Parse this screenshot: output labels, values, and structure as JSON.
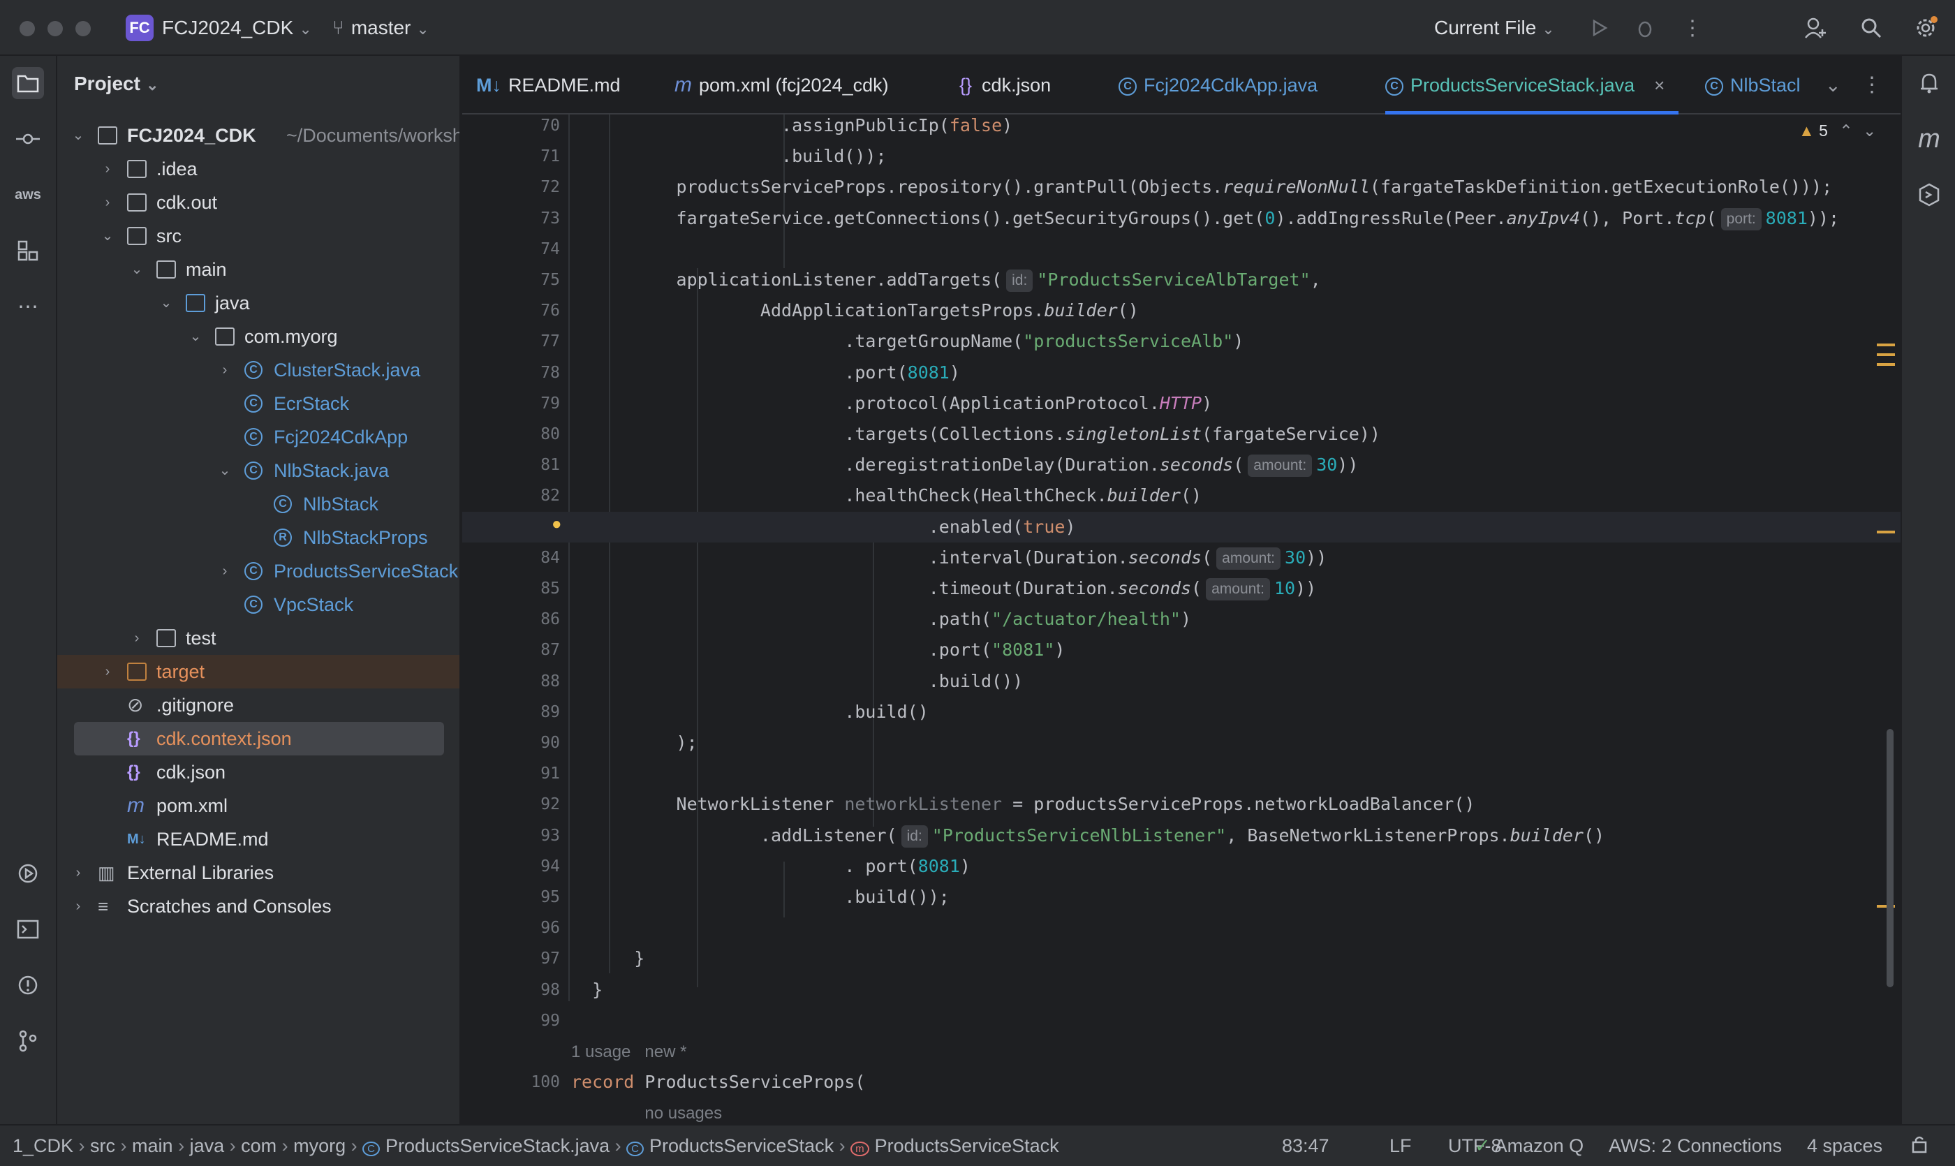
{
  "titlebar": {
    "project_badge": "FC",
    "project_name": "FCJ2024_CDK",
    "branch": "master",
    "run_config": "Current File"
  },
  "sidebar": {
    "title": "Project",
    "tree": [
      {
        "label": "FCJ2024_CDK",
        "path": "~/Documents/worksho",
        "indent": 0,
        "arrow": "⌄",
        "icon": "folder-module"
      },
      {
        "label": ".idea",
        "indent": 1,
        "arrow": "›",
        "icon": "folder"
      },
      {
        "label": "cdk.out",
        "indent": 1,
        "arrow": "›",
        "icon": "folder"
      },
      {
        "label": "src",
        "indent": 1,
        "arrow": "⌄",
        "icon": "folder"
      },
      {
        "label": "main",
        "indent": 2,
        "arrow": "⌄",
        "icon": "folder"
      },
      {
        "label": "java",
        "indent": 3,
        "arrow": "⌄",
        "icon": "folder-blue"
      },
      {
        "label": "com.myorg",
        "indent": 4,
        "arrow": "⌄",
        "icon": "package"
      },
      {
        "label": "ClusterStack.java",
        "indent": 5,
        "arrow": "›",
        "icon": "class"
      },
      {
        "label": "EcrStack",
        "indent": 5,
        "arrow": "",
        "icon": "class"
      },
      {
        "label": "Fcj2024CdkApp",
        "indent": 5,
        "arrow": "",
        "icon": "class"
      },
      {
        "label": "NlbStack.java",
        "indent": 5,
        "arrow": "⌄",
        "icon": "class"
      },
      {
        "label": "NlbStack",
        "indent": 6,
        "arrow": "",
        "icon": "class"
      },
      {
        "label": "NlbStackProps",
        "indent": 6,
        "arrow": "",
        "icon": "record"
      },
      {
        "label": "ProductsServiceStack.j",
        "indent": 5,
        "arrow": "›",
        "icon": "class"
      },
      {
        "label": "VpcStack",
        "indent": 5,
        "arrow": "",
        "icon": "class"
      },
      {
        "label": "test",
        "indent": 2,
        "arrow": "›",
        "icon": "folder"
      },
      {
        "label": "target",
        "indent": 1,
        "arrow": "›",
        "icon": "folder-orange"
      },
      {
        "label": ".gitignore",
        "indent": 1,
        "arrow": "",
        "icon": "ignore"
      },
      {
        "label": "cdk.context.json",
        "indent": 1,
        "arrow": "",
        "icon": "json"
      },
      {
        "label": "cdk.json",
        "indent": 1,
        "arrow": "",
        "icon": "json"
      },
      {
        "label": "pom.xml",
        "indent": 1,
        "arrow": "",
        "icon": "maven"
      },
      {
        "label": "README.md",
        "indent": 1,
        "arrow": "",
        "icon": "markdown"
      },
      {
        "label": "External Libraries",
        "indent": 0,
        "arrow": "›",
        "icon": "library"
      },
      {
        "label": "Scratches and Consoles",
        "indent": 0,
        "arrow": "›",
        "icon": "scratch"
      }
    ]
  },
  "tabs": [
    "README.md",
    "pom.xml (fcj2024_cdk)",
    "cdk.json",
    "Fcj2024CdkApp.java",
    "ProductsServiceStack.java",
    "NlbStacl"
  ],
  "tab_icons": [
    "M↓",
    "m",
    "{}",
    "C",
    "C",
    "C"
  ],
  "editor": {
    "warning_count": "5",
    "line_numbers": [
      "70",
      "71",
      "72",
      "73",
      "74",
      "75",
      "76",
      "77",
      "78",
      "79",
      "80",
      "81",
      "82",
      "83",
      "84",
      "85",
      "86",
      "87",
      "88",
      "89",
      "90",
      "91",
      "92",
      "93",
      "94",
      "95",
      "96",
      "97",
      "98",
      "99",
      "",
      "100",
      ""
    ],
    "inlay": {
      "id": "id:",
      "port": "port:",
      "amount": "amount:"
    },
    "usage_hint": "1 usage",
    "new_hint": "new *",
    "no_usages": "no usages"
  },
  "statusbar": {
    "breadcrumb": [
      "1_CDK",
      "src",
      "main",
      "java",
      "com",
      "myorg",
      "ProductsServiceStack.java",
      "ProductsServiceStack",
      "ProductsServiceStack"
    ],
    "position": "83:47",
    "line_sep": "LF",
    "encoding": "UTF-8",
    "amazon_q": "Amazon Q",
    "aws": "AWS: 2 Connections",
    "indent": "4 spaces"
  }
}
